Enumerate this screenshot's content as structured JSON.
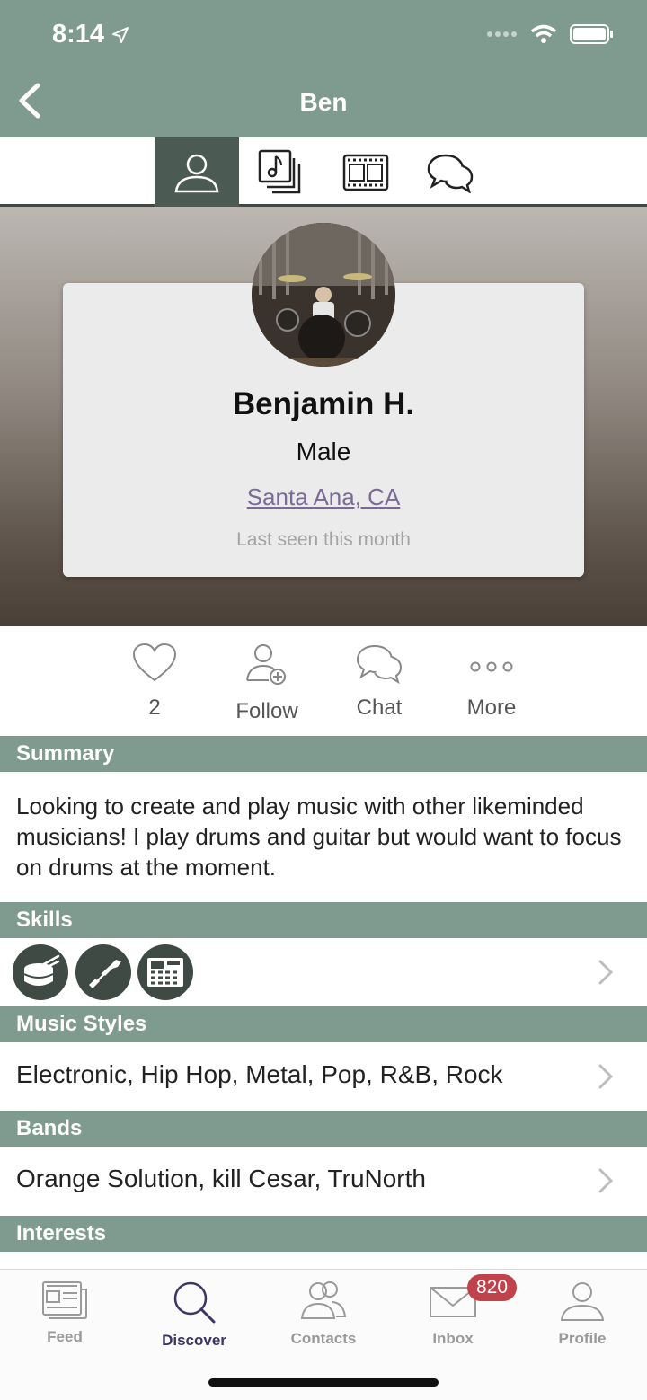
{
  "status": {
    "time": "8:14"
  },
  "nav": {
    "title": "Ben"
  },
  "tabs": [
    {
      "name": "profile",
      "icon": "person-icon",
      "active": true
    },
    {
      "name": "music",
      "icon": "music-notes-icon"
    },
    {
      "name": "video",
      "icon": "film-strip-icon"
    },
    {
      "name": "discussion",
      "icon": "chat-bubbles-icon"
    }
  ],
  "profile": {
    "name": "Benjamin H.",
    "gender": "Male",
    "location": "Santa Ana, CA",
    "last_seen": "Last seen this month"
  },
  "actions": {
    "likes_count": "2",
    "follow": "Follow",
    "chat": "Chat",
    "more": "More"
  },
  "sections": {
    "summary": "Summary",
    "skills": "Skills",
    "music_styles": "Music Styles",
    "bands": "Bands",
    "interests": "Interests"
  },
  "summary_text": "Looking to create and play music with other likeminded musicians!  I play drums and guitar but would want to focus on drums at the moment.",
  "skills": [
    {
      "icon": "drum-icon"
    },
    {
      "icon": "guitar-icon"
    },
    {
      "icon": "drum-machine-icon"
    }
  ],
  "music_styles_text": "Electronic, Hip Hop, Metal, Pop, R&B, Rock",
  "bands_text": "Orange Solution, kill Cesar, TruNorth",
  "bottom_tabs": {
    "feed": "Feed",
    "discover": "Discover",
    "contacts": "Contacts",
    "inbox": "Inbox",
    "profile": "Profile",
    "inbox_badge": "820"
  },
  "colors": {
    "header": "#7f9a8e",
    "active_tab": "#4b5b54",
    "link": "#7a6b96",
    "badge": "#c0424a"
  }
}
